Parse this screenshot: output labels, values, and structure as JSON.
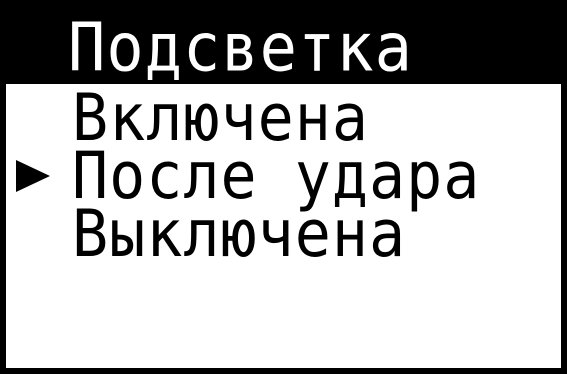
{
  "menu": {
    "title": "Подсветка",
    "items": [
      {
        "label": "Включена",
        "selected": false
      },
      {
        "label": "После удара",
        "selected": true
      },
      {
        "label": "Выключена",
        "selected": false
      }
    ]
  },
  "colors": {
    "background": "#ffffff",
    "foreground": "#000000",
    "title_background": "#000000",
    "title_text": "#ffffff"
  },
  "icons": {
    "selection_cursor": "triangle-right-icon"
  }
}
